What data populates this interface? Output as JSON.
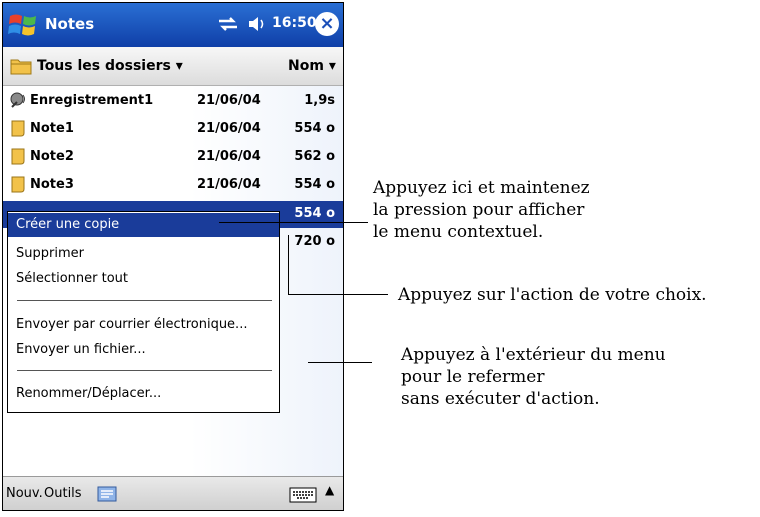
{
  "titlebar": {
    "app_title": "Notes",
    "clock": "16:50",
    "close_symbol": "×",
    "icons": [
      "windows-logo-icon",
      "connectivity-icon",
      "volume-icon",
      "close-icon"
    ]
  },
  "folderbar": {
    "folder_label": "Tous les dossiers",
    "sort_label": "Nom"
  },
  "files": [
    {
      "name": "Enregistrement1",
      "date": "21/06/04",
      "size": "1,9s",
      "icon": "recording-icon"
    },
    {
      "name": "Note1",
      "date": "21/06/04",
      "size": "554 o",
      "icon": "note-icon"
    },
    {
      "name": "Note2",
      "date": "21/06/04",
      "size": "562 o",
      "icon": "note-icon"
    },
    {
      "name": "Note3",
      "date": "21/06/04",
      "size": "554 o",
      "icon": "note-icon"
    },
    {
      "name": "",
      "date": "",
      "size": "554 o",
      "icon": "note-icon"
    },
    {
      "name": "",
      "date": "",
      "size": "720 o",
      "icon": "note-icon"
    }
  ],
  "context_menu": {
    "items": [
      "Créer une copie",
      "Supprimer",
      "Sélectionner tout",
      "Envoyer par courrier électronique...",
      "Envoyer un fichier...",
      "Renommer/Déplacer..."
    ],
    "highlighted_index": 0
  },
  "bottombar": {
    "new_label": "Nouv.",
    "tools_label": "Outils",
    "arrow": "▲"
  },
  "annotations": {
    "hold": [
      "Appuyez ici et maintenez",
      "la pression pour afficher",
      "le menu contextuel."
    ],
    "choose": [
      "Appuyez sur l'action de votre choix."
    ],
    "outside": [
      "Appuyez à l'extérieur du menu",
      "pour le refermer",
      "sans exécuter d'action."
    ]
  },
  "colors": {
    "titlebar": "#1c4fb8",
    "selection": "#1a3c9a"
  }
}
